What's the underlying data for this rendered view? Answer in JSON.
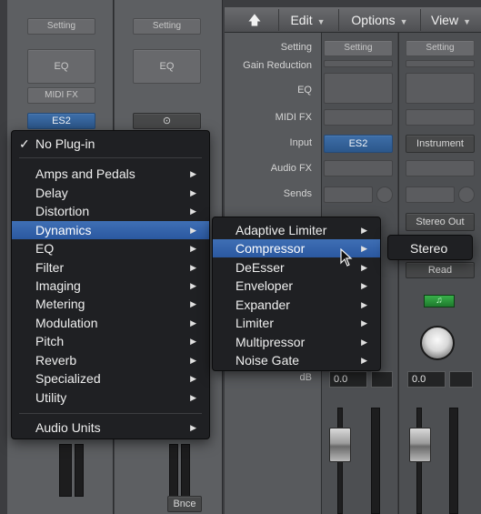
{
  "left_strips": {
    "strip1": {
      "setting": "Setting",
      "eq": "EQ",
      "midi_fx": "MIDI FX",
      "instrument": "ES2"
    },
    "strip2": {
      "setting": "Setting",
      "eq": "EQ",
      "link_symbol": "⊙",
      "bounce": "Bnce"
    }
  },
  "toolbar": {
    "back_icon": "arrow-up-icon",
    "edit": "Edit",
    "options": "Options",
    "view": "View",
    "dropdown_glyph": "▼"
  },
  "right_mixer": {
    "labels": {
      "setting": "Setting",
      "gain_reduction": "Gain Reduction",
      "eq": "EQ",
      "midi_fx": "MIDI FX",
      "input": "Input",
      "audio_fx": "Audio FX",
      "sends": "Sends",
      "db": "dB"
    },
    "strip_a": {
      "setting": "Setting",
      "input": "ES2",
      "volume": "0.0"
    },
    "strip_b": {
      "setting": "Setting",
      "input": "Instrument",
      "output": "Stereo Out",
      "automation": "Read",
      "volume": "0.0"
    }
  },
  "menus": {
    "main": {
      "no_plugin": "No Plug-in",
      "checkmark": "✓",
      "items": [
        "Amps and Pedals",
        "Delay",
        "Distortion",
        "Dynamics",
        "EQ",
        "Filter",
        "Imaging",
        "Metering",
        "Modulation",
        "Pitch",
        "Reverb",
        "Specialized",
        "Utility"
      ],
      "audio_units": "Audio Units",
      "submenu_arrow": "▶",
      "selected": "Dynamics"
    },
    "dynamics": {
      "items": [
        "Adaptive Limiter",
        "Compressor",
        "DeEsser",
        "Enveloper",
        "Expander",
        "Limiter",
        "Multipressor",
        "Noise Gate"
      ],
      "selected": "Compressor"
    },
    "compressor": {
      "items": [
        "Stereo"
      ]
    }
  },
  "colors": {
    "menu_bg": "#1f2023",
    "selection": "#2f5da6",
    "plugin_slot": "#3d6ea8"
  }
}
